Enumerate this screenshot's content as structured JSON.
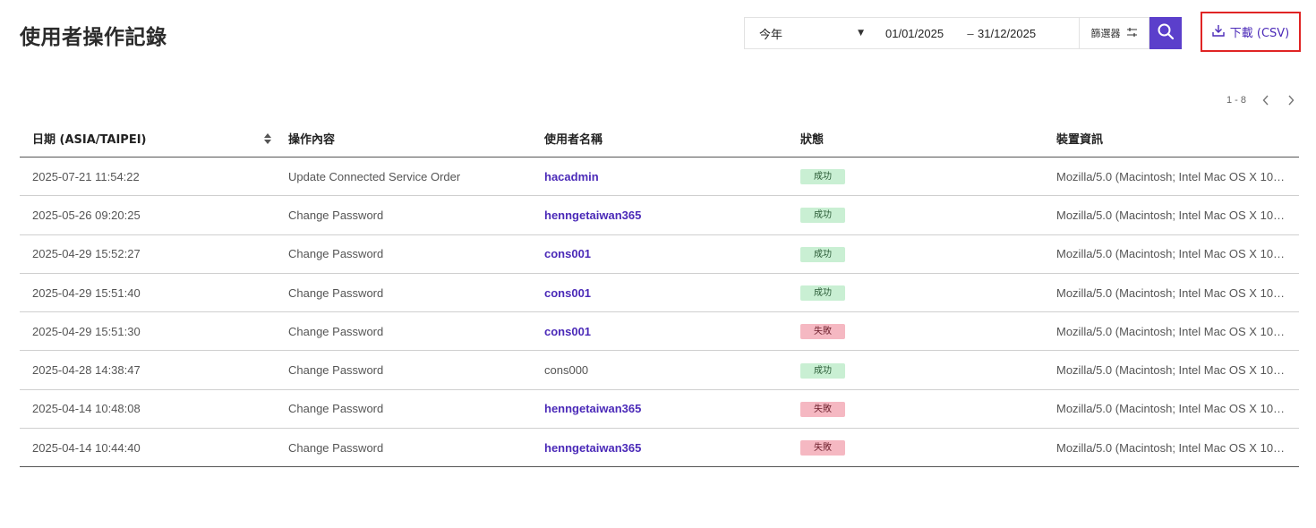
{
  "page": {
    "title": "使用者操作記錄"
  },
  "toolbar": {
    "period": "今年",
    "date_start": "01/01/2025",
    "date_sep": "–",
    "date_end": "31/12/2025",
    "filter_label": "篩選器",
    "download_label": "下載 (CSV)"
  },
  "pagination": {
    "range": "1 - 8"
  },
  "table": {
    "headers": [
      "日期 (ASIA/TAIPEI)",
      "操作內容",
      "使用者名稱",
      "狀態",
      "裝置資訊"
    ],
    "rows": [
      {
        "date": "2025-07-21 11:54:22",
        "action": "Update Connected Service Order",
        "user": "hacadmin",
        "user_link": true,
        "status": "成功",
        "status_type": "success",
        "device": "Mozilla/5.0 (Macintosh; Intel Mac OS X 10_…"
      },
      {
        "date": "2025-05-26 09:20:25",
        "action": "Change Password",
        "user": "henngetaiwan365",
        "user_link": true,
        "status": "成功",
        "status_type": "success",
        "device": "Mozilla/5.0 (Macintosh; Intel Mac OS X 10_…"
      },
      {
        "date": "2025-04-29 15:52:27",
        "action": "Change Password",
        "user": "cons001",
        "user_link": true,
        "status": "成功",
        "status_type": "success",
        "device": "Mozilla/5.0 (Macintosh; Intel Mac OS X 10_…"
      },
      {
        "date": "2025-04-29 15:51:40",
        "action": "Change Password",
        "user": "cons001",
        "user_link": true,
        "status": "成功",
        "status_type": "success",
        "device": "Mozilla/5.0 (Macintosh; Intel Mac OS X 10_…"
      },
      {
        "date": "2025-04-29 15:51:30",
        "action": "Change Password",
        "user": "cons001",
        "user_link": true,
        "status": "失敗",
        "status_type": "fail",
        "device": "Mozilla/5.0 (Macintosh; Intel Mac OS X 10_…"
      },
      {
        "date": "2025-04-28 14:38:47",
        "action": "Change Password",
        "user": "cons000",
        "user_link": false,
        "status": "成功",
        "status_type": "success",
        "device": "Mozilla/5.0 (Macintosh; Intel Mac OS X 10_…"
      },
      {
        "date": "2025-04-14 10:48:08",
        "action": "Change Password",
        "user": "henngetaiwan365",
        "user_link": true,
        "status": "失敗",
        "status_type": "fail",
        "device": "Mozilla/5.0 (Macintosh; Intel Mac OS X 10_…"
      },
      {
        "date": "2025-04-14 10:44:40",
        "action": "Change Password",
        "user": "henngetaiwan365",
        "user_link": true,
        "status": "失敗",
        "status_type": "fail",
        "device": "Mozilla/5.0 (Macintosh; Intel Mac OS X 10_…"
      }
    ]
  },
  "colors": {
    "accent": "#5b3fcb",
    "link": "#4b2ab8",
    "success_bg": "#c9efd3",
    "fail_bg": "#f5b8c2",
    "highlight": "#e02424"
  },
  "icons": {
    "period_caret": "caret-down-icon",
    "filter": "sliders-icon",
    "search": "search-icon",
    "download": "download-icon",
    "sort": "sort-icon",
    "prev": "chevron-left-icon",
    "next": "chevron-right-icon"
  }
}
